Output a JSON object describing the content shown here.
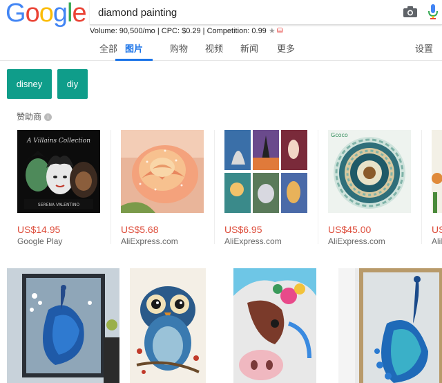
{
  "logo": {
    "letters": [
      "G",
      "o",
      "o",
      "g",
      "l",
      "e"
    ],
    "colors": [
      "#4285f4",
      "#ea4335",
      "#fbbc05",
      "#4285f4",
      "#34a853",
      "#ea4335"
    ]
  },
  "search": {
    "query": "diamond painting"
  },
  "stats": {
    "text": "Volume: 90,500/mo | CPC: $0.29 | Competition: 0.99",
    "star": "★",
    "db": "⛁"
  },
  "tabs": [
    "全部",
    "图片",
    "购物",
    "视频",
    "新闻",
    "更多"
  ],
  "active_tab": "图片",
  "settings_label": "设置",
  "chips": [
    "disney",
    "diy"
  ],
  "sponsor": {
    "label": "赞助商",
    "info": "i"
  },
  "ads": [
    {
      "price": "US$14.95",
      "store": "Google Play",
      "image": "villains collection poster"
    },
    {
      "price": "US$5.68",
      "store": "AliExpress.com",
      "image": "peach rose"
    },
    {
      "price": "US$6.95",
      "store": "AliExpress.com",
      "image": "fantasy grid"
    },
    {
      "price": "US$45.00",
      "store": "AliExpress.com",
      "image": "mandala"
    },
    {
      "price": "US$",
      "store": "AliE",
      "image": "flowers"
    }
  ],
  "villains_art": {
    "title": "A Villains Collection",
    "artist": "SERENA VALENTINO"
  },
  "mandala_art": {
    "brand": "Gcoco"
  },
  "results": [
    "blue peacock wall art",
    "blue owl",
    "colorful cow",
    "peacock on white"
  ],
  "colors": {
    "accent": "#1a73e8",
    "chip": "#0f9d8a",
    "price": "#dd4b39"
  }
}
